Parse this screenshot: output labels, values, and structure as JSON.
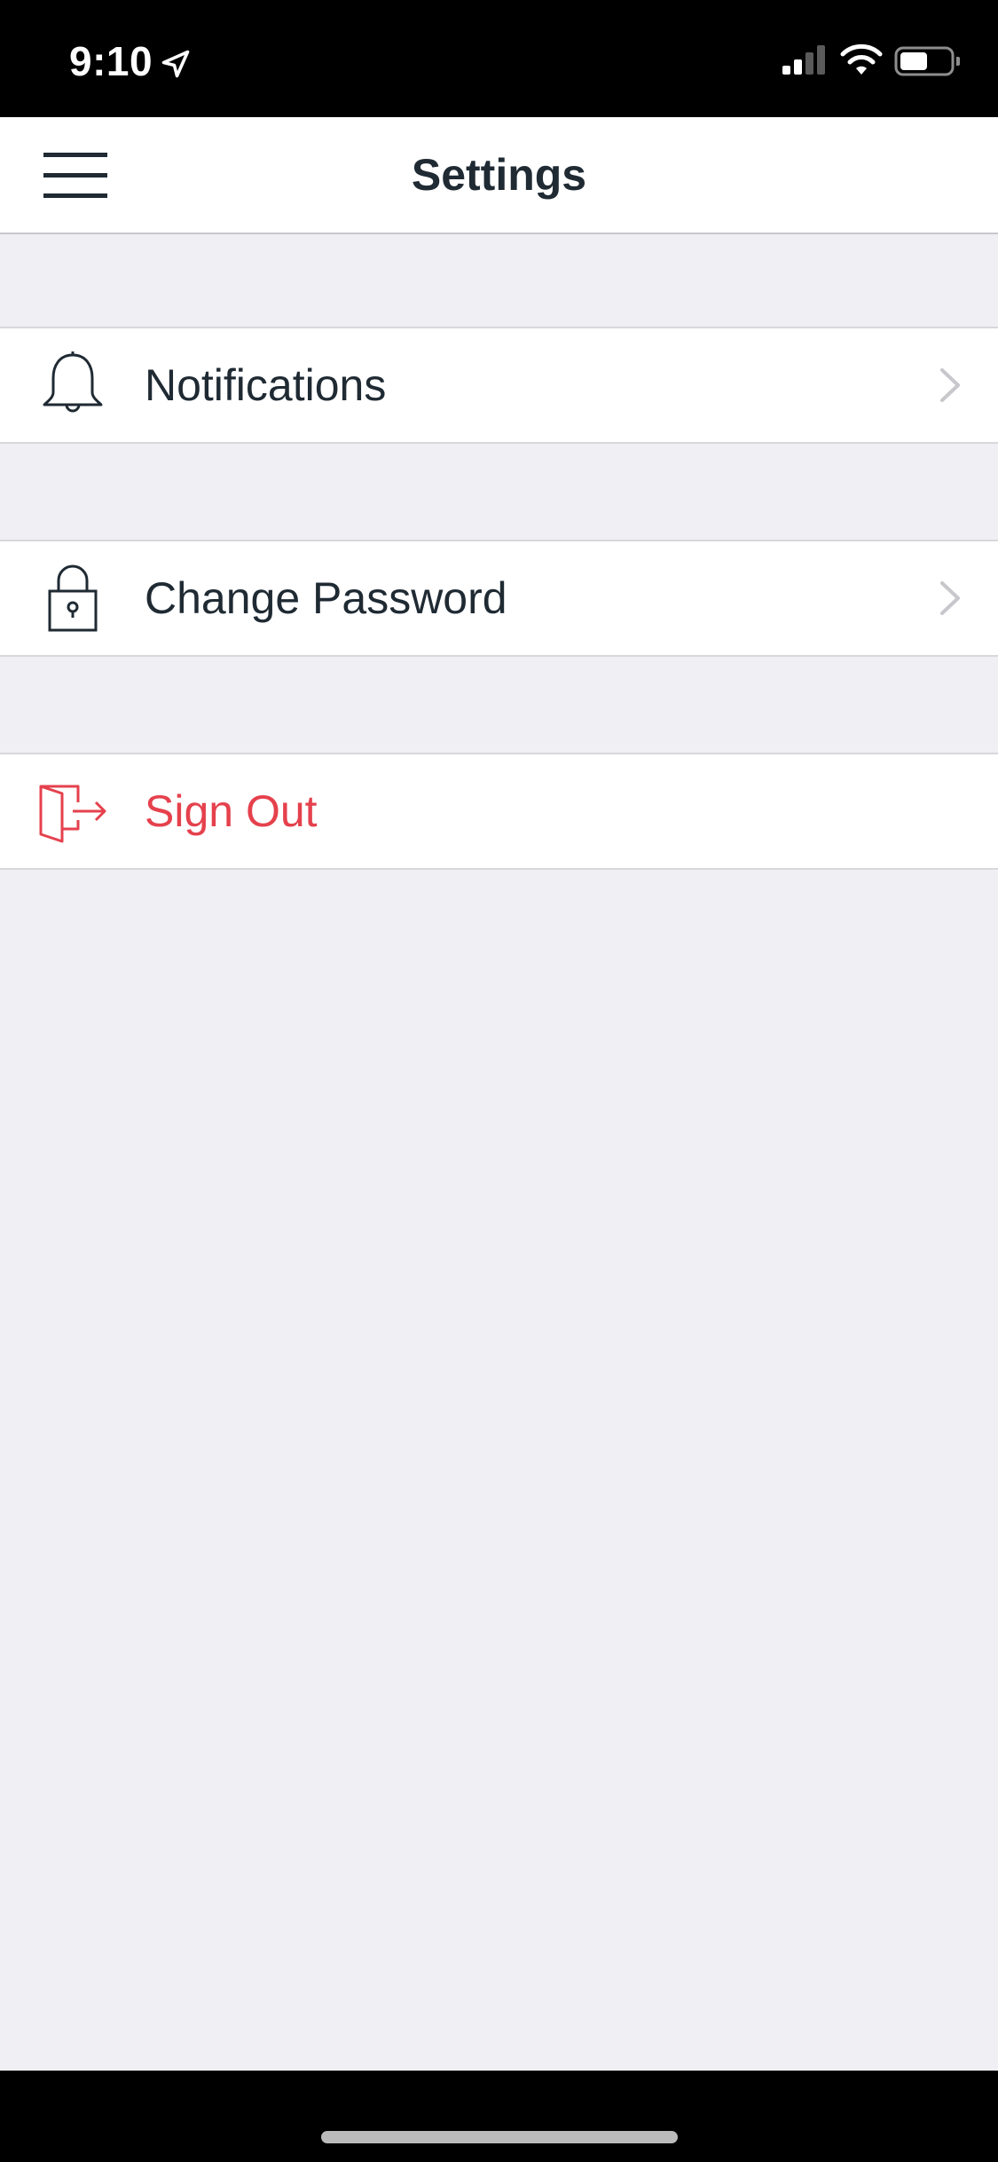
{
  "status_bar": {
    "time": "9:10",
    "icons": [
      "location-arrow-icon",
      "cellular-signal-icon",
      "wifi-icon",
      "battery-icon"
    ]
  },
  "nav": {
    "title": "Settings",
    "menu_icon": "hamburger-menu-icon"
  },
  "settings": {
    "items": [
      {
        "label": "Notifications",
        "icon": "bell-icon",
        "has_chevron": true
      },
      {
        "label": "Change Password",
        "icon": "lock-icon",
        "has_chevron": true
      },
      {
        "label": "Sign Out",
        "icon": "sign-out-icon",
        "has_chevron": false
      }
    ]
  },
  "colors": {
    "background": "#efeff4",
    "surface": "#ffffff",
    "text": "#1f2a33",
    "danger": "#e5414d",
    "chevron": "#c7c7cc"
  }
}
